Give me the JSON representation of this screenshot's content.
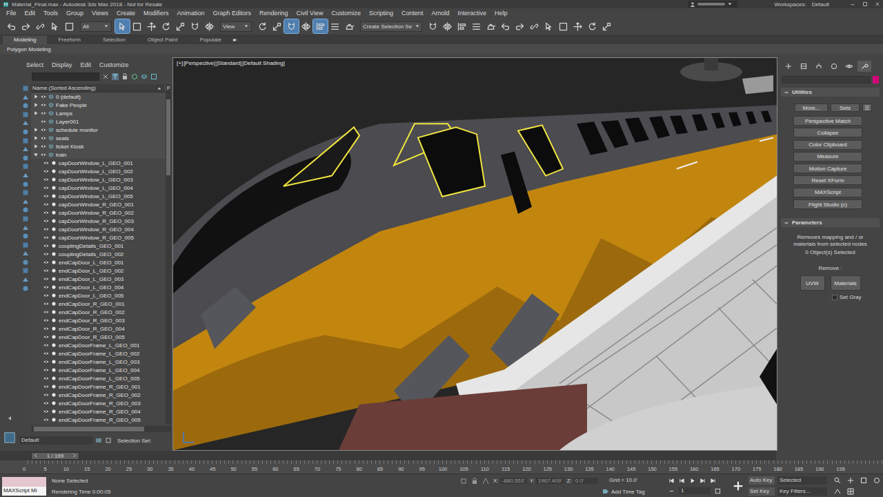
{
  "window": {
    "title": "Material_Final.max - Autodesk 3ds Max 2018 - Not for Resale"
  },
  "workspaces": {
    "label": "Workspaces:",
    "value": "Default"
  },
  "menu": [
    "File",
    "Edit",
    "Tools",
    "Group",
    "Views",
    "Create",
    "Modifiers",
    "Animation",
    "Graph Editors",
    "Rendering",
    "Civil View",
    "Customize",
    "Scripting",
    "Content",
    "Arnold",
    "Interactive",
    "Help"
  ],
  "toolbar": {
    "filter": "All",
    "view": "View",
    "selection_set": "Create Selection Se",
    "tools_left": [
      {
        "selected": false
      },
      {
        "selected": false
      },
      {
        "selected": false
      },
      {
        "selected": false
      },
      {
        "selected": false
      }
    ],
    "tools_mid": [
      {
        "selected": true
      },
      {
        "selected": false
      },
      {
        "selected": false
      },
      {
        "selected": false
      },
      {
        "selected": false
      },
      {
        "selected": false
      },
      {
        "selected": false
      }
    ],
    "tools_right": [
      {
        "selected": false
      },
      {
        "selected": false
      },
      {
        "selected": true
      },
      {
        "selected": false
      },
      {
        "selected": true
      },
      {
        "selected": false
      },
      {
        "selected": false
      }
    ],
    "tools_end": [
      {
        "selected": false
      },
      {
        "selected": false
      },
      {
        "selected": false
      },
      {
        "selected": false
      },
      {
        "selected": false
      },
      {
        "selected": false
      },
      {
        "selected": false
      },
      {
        "selected": false
      },
      {
        "selected": false
      },
      {
        "selected": false
      },
      {
        "selected": false
      },
      {
        "selected": false
      },
      {
        "selected": false
      }
    ]
  },
  "ribbon": {
    "tabs": [
      {
        "label": "Modeling",
        "selected": true
      },
      {
        "label": "Freeform",
        "selected": false
      },
      {
        "label": "Selection",
        "selected": false
      },
      {
        "label": "Object Paint",
        "selected": false
      },
      {
        "label": "Populate",
        "selected": false
      }
    ],
    "panel": "Polygon Modeling"
  },
  "explorer": {
    "menu": [
      "Select",
      "Display",
      "Edit",
      "Customize"
    ],
    "column": "Name (Sorted Ascending)",
    "next_column": "F",
    "rows": [
      {
        "name": "0 (default)",
        "kind": "layer",
        "expandable": true,
        "expanded": false
      },
      {
        "name": "Fake People",
        "kind": "layer",
        "expandable": true,
        "expanded": false
      },
      {
        "name": "Lamps",
        "kind": "layer",
        "expandable": true,
        "expanded": false
      },
      {
        "name": "Layer001",
        "kind": "layer",
        "expandable": false,
        "expanded": false
      },
      {
        "name": "schedule monitor",
        "kind": "layer",
        "expandable": true,
        "expanded": false
      },
      {
        "name": "seats",
        "kind": "layer",
        "expandable": true,
        "expanded": false
      },
      {
        "name": "ticket Kiosk",
        "kind": "layer",
        "expandable": true,
        "expanded": false
      },
      {
        "name": "train",
        "kind": "layer",
        "expandable": true,
        "expanded": true
      },
      {
        "name": "capDoorWindow_L_GEO_001",
        "kind": "object",
        "expandable": false,
        "expanded": false
      },
      {
        "name": "capDoorWindow_L_GEO_002",
        "kind": "object",
        "expandable": false,
        "expanded": false
      },
      {
        "name": "capDoorWindow_L_GEO_003",
        "kind": "object",
        "expandable": false,
        "expanded": false
      },
      {
        "name": "capDoorWindow_L_GEO_004",
        "kind": "object",
        "expandable": false,
        "expanded": false
      },
      {
        "name": "capDoorWindow_L_GEO_005",
        "kind": "object",
        "expandable": false,
        "expanded": false
      },
      {
        "name": "capDoorWindow_R_GEO_001",
        "kind": "object",
        "expandable": false,
        "expanded": false
      },
      {
        "name": "capDoorWindow_R_GEO_002",
        "kind": "object",
        "expandable": false,
        "expanded": false
      },
      {
        "name": "capDoorWindow_R_GEO_003",
        "kind": "object",
        "expandable": false,
        "expanded": false
      },
      {
        "name": "capDoorWindow_R_GEO_004",
        "kind": "object",
        "expandable": false,
        "expanded": false
      },
      {
        "name": "capDoorWindow_R_GEO_005",
        "kind": "object",
        "expandable": false,
        "expanded": false
      },
      {
        "name": "couplingDetails_GEO_001",
        "kind": "object",
        "expandable": false,
        "expanded": false
      },
      {
        "name": "couplingDetails_GEO_002",
        "kind": "object",
        "expandable": false,
        "expanded": false
      },
      {
        "name": "endCapDoor_L_GEO_001",
        "kind": "object",
        "expandable": false,
        "expanded": false
      },
      {
        "name": "endCapDoor_L_GEO_002",
        "kind": "object",
        "expandable": false,
        "expanded": false
      },
      {
        "name": "endCapDoor_L_GEO_003",
        "kind": "object",
        "expandable": false,
        "expanded": false
      },
      {
        "name": "endCapDoor_L_GEO_004",
        "kind": "object",
        "expandable": false,
        "expanded": false
      },
      {
        "name": "endCapDoor_L_GEO_005",
        "kind": "object",
        "expandable": false,
        "expanded": false
      },
      {
        "name": "endCapDoor_R_GEO_001",
        "kind": "object",
        "expandable": false,
        "expanded": false
      },
      {
        "name": "endCapDoor_R_GEO_002",
        "kind": "object",
        "expandable": false,
        "expanded": false
      },
      {
        "name": "endCapDoor_R_GEO_003",
        "kind": "object",
        "expandable": false,
        "expanded": false
      },
      {
        "name": "endCapDoor_R_GEO_004",
        "kind": "object",
        "expandable": false,
        "expanded": false
      },
      {
        "name": "endCapDoor_R_GEO_005",
        "kind": "object",
        "expandable": false,
        "expanded": false
      },
      {
        "name": "endCapDoorFrame_L_GEO_001",
        "kind": "object",
        "expandable": false,
        "expanded": false
      },
      {
        "name": "endCapDoorFrame_L_GEO_002",
        "kind": "object",
        "expandable": false,
        "expanded": false
      },
      {
        "name": "endCapDoorFrame_L_GEO_003",
        "kind": "object",
        "expandable": false,
        "expanded": false
      },
      {
        "name": "endCapDoorFrame_L_GEO_004",
        "kind": "object",
        "expandable": false,
        "expanded": false
      },
      {
        "name": "endCapDoorFrame_L_GEO_005",
        "kind": "object",
        "expandable": false,
        "expanded": false
      },
      {
        "name": "endCapDoorFrame_R_GEO_001",
        "kind": "object",
        "expandable": false,
        "expanded": false
      },
      {
        "name": "endCapDoorFrame_R_GEO_002",
        "kind": "object",
        "expandable": false,
        "expanded": false
      },
      {
        "name": "endCapDoorFrame_R_GEO_003",
        "kind": "object",
        "expandable": false,
        "expanded": false
      },
      {
        "name": "endCapDoorFrame_R_GEO_004",
        "kind": "object",
        "expandable": false,
        "expanded": false
      },
      {
        "name": "endCapDoorFrame_R_GEO_005",
        "kind": "object",
        "expandable": false,
        "expanded": false
      }
    ],
    "layer": "Default",
    "selection_set_label": "Selection Set:"
  },
  "viewport": {
    "labels": [
      "[+]",
      "[Perspective]",
      "[Standard]",
      "[Default Shading]"
    ]
  },
  "command_panel": {
    "tabs": [
      {
        "selected": false
      },
      {
        "selected": false
      },
      {
        "selected": false
      },
      {
        "selected": false
      },
      {
        "selected": false
      },
      {
        "selected": true
      }
    ],
    "utilities": {
      "title": "Utilities",
      "more": "More...",
      "sets": "Sets",
      "buttons": [
        "Perspective Match",
        "Collapse",
        "Color Clipboard",
        "Measure",
        "Motion Capture",
        "Reset XForm",
        "MAXScript",
        "Flight Studio (c)"
      ]
    },
    "parameters": {
      "title": "Parameters",
      "description": "Removes mapping and / or materials from selected nodes",
      "count": "0 Object(s) Selected",
      "remove_label": "Remove :",
      "buttons": [
        "UVW",
        "Materials"
      ],
      "set_gray": {
        "label": "Set Gray",
        "checked": false
      }
    }
  },
  "timeline": {
    "frame": "1 / 199",
    "level": 0.005,
    "ticks": [
      "0",
      "5",
      "10",
      "15",
      "20",
      "25",
      "30",
      "35",
      "40",
      "45",
      "50",
      "55",
      "60",
      "65",
      "70",
      "75",
      "80",
      "85",
      "90",
      "95",
      "100",
      "105",
      "110",
      "115",
      "120",
      "125",
      "130",
      "135",
      "140",
      "145",
      "150",
      "155",
      "160",
      "165",
      "170",
      "175",
      "180",
      "185",
      "190",
      "195"
    ]
  },
  "status_bar": {
    "maxscript": "MAXScript Mi",
    "selection": "None Selected",
    "render_time": "Rendering Time  0:00:05",
    "coords": [
      {
        "label": "X:",
        "value": "-880.553'"
      },
      {
        "label": "Y:",
        "value": "1967.409'"
      },
      {
        "label": "Z:",
        "value": "0.0'"
      }
    ],
    "grid": "Grid = 10.0'",
    "add_time_tag": "Add Time Tag",
    "auto_key": "Auto Key",
    "key_mode": "Selected",
    "set_key": "Set Key",
    "key_filters": "Key Filters...",
    "current_frame": "1"
  }
}
